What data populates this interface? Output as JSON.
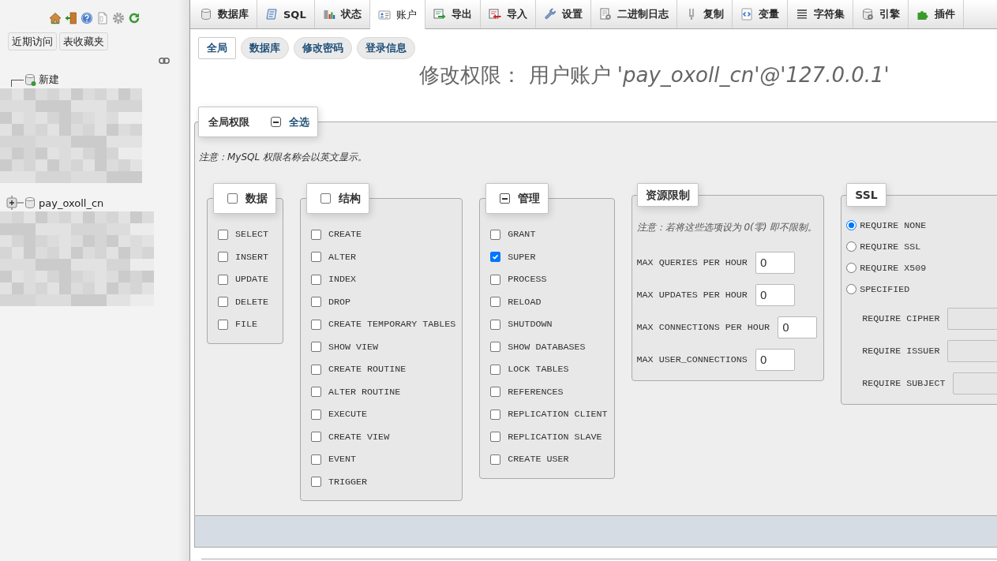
{
  "sidebar": {
    "buttons": [
      "近期访问",
      "表收藏夹"
    ],
    "tree": [
      {
        "kind": "new",
        "label": "新建"
      },
      {
        "kind": "database",
        "label": "pay_oxoll_cn",
        "expanded": false
      }
    ]
  },
  "top_tabs": [
    {
      "label": "数据库",
      "selected": false
    },
    {
      "label": "SQL",
      "selected": false
    },
    {
      "label": "状态",
      "selected": false
    },
    {
      "label": "账户",
      "selected": true
    },
    {
      "label": "导出",
      "selected": false
    },
    {
      "label": "导入",
      "selected": false
    },
    {
      "label": "设置",
      "selected": false
    },
    {
      "label": "二进制日志",
      "selected": false
    },
    {
      "label": "复制",
      "selected": false
    },
    {
      "label": "变量",
      "selected": false
    },
    {
      "label": "字符集",
      "selected": false
    },
    {
      "label": "引擎",
      "selected": false
    },
    {
      "label": "插件",
      "selected": false
    }
  ],
  "sub_tabs": [
    {
      "label": "全局",
      "selected": true
    },
    {
      "label": "数据库",
      "selected": false
    },
    {
      "label": "修改密码",
      "selected": false
    },
    {
      "label": "登录信息",
      "selected": false
    }
  ],
  "title": "修改权限： 用户账户 *'pay_oxoll_cn'@'127.0.0.1'*",
  "global_privileges": {
    "legend": "全局权限",
    "select_all": {
      "label": "全选",
      "checked": false,
      "indeterminate": true
    },
    "note": "注意：MySQL 权限名称会以英文显示。",
    "groups": [
      {
        "kind": "checkboxes",
        "legend": "数据",
        "checked": false,
        "indeterminate": false,
        "items": [
          {
            "label": "SELECT",
            "checked": false
          },
          {
            "label": "INSERT",
            "checked": false
          },
          {
            "label": "UPDATE",
            "checked": false
          },
          {
            "label": "DELETE",
            "checked": false
          },
          {
            "label": "FILE",
            "checked": false
          }
        ]
      },
      {
        "kind": "checkboxes",
        "legend": "结构",
        "checked": false,
        "indeterminate": false,
        "items": [
          {
            "label": "CREATE",
            "checked": false
          },
          {
            "label": "ALTER",
            "checked": false
          },
          {
            "label": "INDEX",
            "checked": false
          },
          {
            "label": "DROP",
            "checked": false
          },
          {
            "label": "CREATE TEMPORARY TABLES",
            "checked": false
          },
          {
            "label": "SHOW VIEW",
            "checked": false
          },
          {
            "label": "CREATE ROUTINE",
            "checked": false
          },
          {
            "label": "ALTER ROUTINE",
            "checked": false
          },
          {
            "label": "EXECUTE",
            "checked": false
          },
          {
            "label": "CREATE VIEW",
            "checked": false
          },
          {
            "label": "EVENT",
            "checked": false
          },
          {
            "label": "TRIGGER",
            "checked": false
          }
        ]
      },
      {
        "kind": "checkboxes",
        "legend": "管理",
        "checked": false,
        "indeterminate": true,
        "items": [
          {
            "label": "GRANT",
            "checked": false
          },
          {
            "label": "SUPER",
            "checked": true
          },
          {
            "label": "PROCESS",
            "checked": false
          },
          {
            "label": "RELOAD",
            "checked": false
          },
          {
            "label": "SHUTDOWN",
            "checked": false
          },
          {
            "label": "SHOW DATABASES",
            "checked": false
          },
          {
            "label": "LOCK TABLES",
            "checked": false
          },
          {
            "label": "REFERENCES",
            "checked": false
          },
          {
            "label": "REPLICATION CLIENT",
            "checked": false
          },
          {
            "label": "REPLICATION SLAVE",
            "checked": false
          },
          {
            "label": "CREATE USER",
            "checked": false
          }
        ]
      },
      {
        "kind": "limits",
        "legend": "资源限制",
        "note": "注意：若将这些选项设为 0(零) 即不限制。",
        "fields": [
          {
            "label": "MAX QUERIES PER HOUR",
            "value": "0",
            "disabled": false
          },
          {
            "label": "MAX UPDATES PER HOUR",
            "value": "0",
            "disabled": false
          },
          {
            "label": "MAX CONNECTIONS PER HOUR",
            "value": "0",
            "disabled": false
          },
          {
            "label": "MAX USER_CONNECTIONS",
            "value": "0",
            "disabled": false
          }
        ]
      },
      {
        "kind": "ssl",
        "legend": "SSL",
        "options": [
          {
            "label": "REQUIRE NONE",
            "selected": true
          },
          {
            "label": "REQUIRE SSL",
            "selected": false
          },
          {
            "label": "REQUIRE X509",
            "selected": false
          },
          {
            "label": "SPECIFIED",
            "selected": false
          }
        ],
        "fields": [
          {
            "label": "REQUIRE CIPHER",
            "disabled": true
          },
          {
            "label": "REQUIRE ISSUER",
            "disabled": true
          },
          {
            "label": "REQUIRE SUBJECT",
            "disabled": true
          }
        ]
      }
    ]
  }
}
